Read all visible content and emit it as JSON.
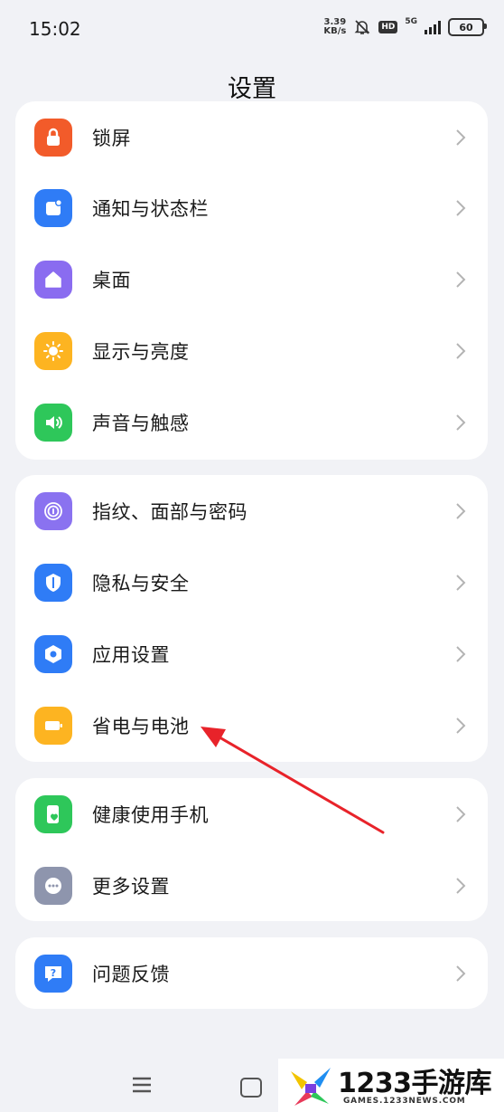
{
  "status_bar": {
    "time": "15:02",
    "net_speed_value": "3.39",
    "net_speed_unit": "KB/s",
    "hd_badge": "HD",
    "network_type": "5G",
    "battery_level": "60",
    "icons": [
      "mute-bell-icon",
      "signal-icon",
      "battery-icon"
    ]
  },
  "header": {
    "title": "设置"
  },
  "groups": [
    {
      "items": [
        {
          "label": "锁屏",
          "icon": "lock-icon",
          "color": "#f25b2a"
        },
        {
          "label": "通知与状态栏",
          "icon": "notification-icon",
          "color": "#2f7cf6"
        },
        {
          "label": "桌面",
          "icon": "home-icon",
          "color": "#8a6cf0"
        },
        {
          "label": "显示与亮度",
          "icon": "sun-icon",
          "color": "#fdb421"
        },
        {
          "label": "声音与触感",
          "icon": "speaker-icon",
          "color": "#2ec75a"
        }
      ]
    },
    {
      "items": [
        {
          "label": "指纹、面部与密码",
          "icon": "fingerprint-icon",
          "color": "#8a72f0"
        },
        {
          "label": "隐私与安全",
          "icon": "shield-icon",
          "color": "#2f7cf6"
        },
        {
          "label": "应用设置",
          "icon": "app-settings-icon",
          "color": "#2f7cf6"
        },
        {
          "label": "省电与电池",
          "icon": "battery-saver-icon",
          "color": "#fdb421"
        }
      ]
    },
    {
      "items": [
        {
          "label": "健康使用手机",
          "icon": "healthy-use-icon",
          "color": "#2ec75a"
        },
        {
          "label": "更多设置",
          "icon": "more-icon",
          "color": "#8e95ad"
        }
      ]
    },
    {
      "items": [
        {
          "label": "问题反馈",
          "icon": "feedback-icon",
          "color": "#2f7cf6"
        }
      ]
    }
  ],
  "nav_bar": {
    "icons": [
      "menu-icon",
      "home-button-icon"
    ]
  },
  "annotation": {
    "color": "#e8232a",
    "points_to": "省电与电池"
  },
  "watermark": {
    "title": "1233手游库",
    "subtitle": "GAMES.1233NEWS.COM"
  }
}
